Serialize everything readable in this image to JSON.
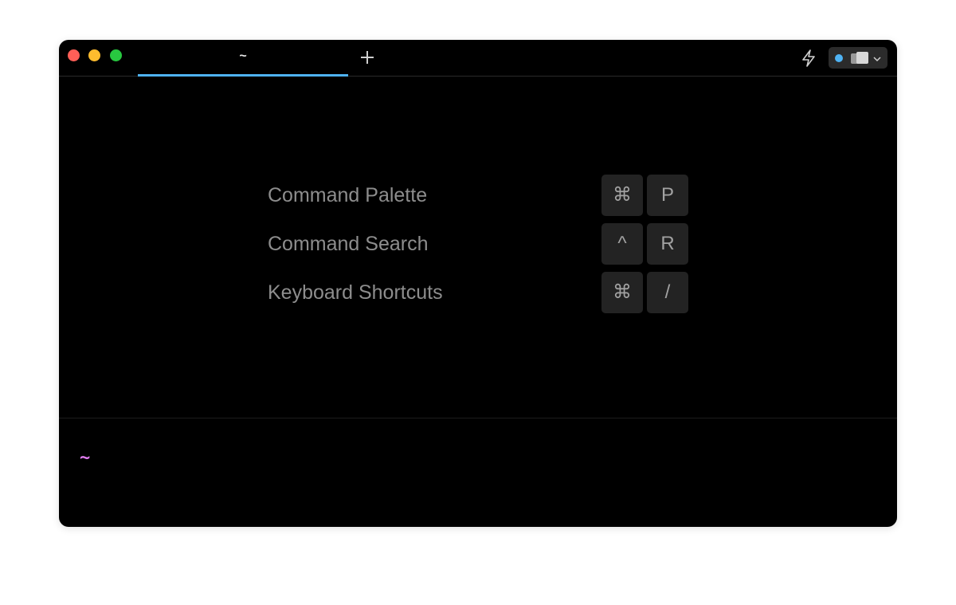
{
  "window": {
    "traffic_lights": {
      "close_color": "#ff5f57",
      "minimize_color": "#febc2e",
      "zoom_color": "#28c840"
    }
  },
  "tabs": [
    {
      "label": "~",
      "active": true,
      "underline_color": "#4fb3f4"
    }
  ],
  "toolbar": {
    "new_tab_icon": "plus-icon",
    "warp_ai_icon": "lightning-bolt-icon",
    "user_menu": {
      "status_dot_color": "#4fb3f4",
      "avatar_icon": "avatar-icon",
      "chevron_icon": "chevron-down-icon"
    }
  },
  "shortcuts": [
    {
      "label": "Command Palette",
      "keys": [
        "⌘",
        "P"
      ]
    },
    {
      "label": "Command Search",
      "keys": [
        "^",
        "R"
      ]
    },
    {
      "label": "Keyboard Shortcuts",
      "keys": [
        "⌘",
        "/"
      ]
    }
  ],
  "prompt": {
    "text": "~",
    "color": "#e07cf0"
  }
}
